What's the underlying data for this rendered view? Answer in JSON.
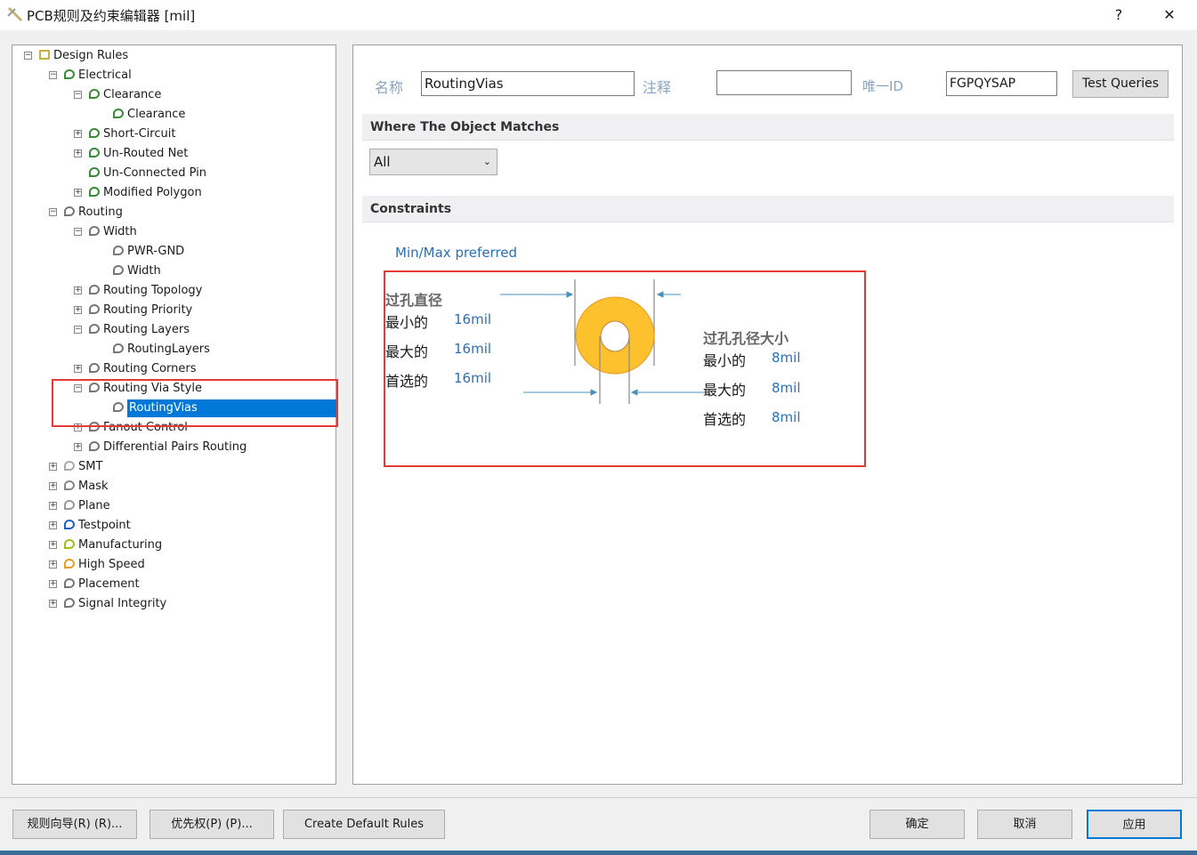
{
  "window": {
    "title": "PCB规则及约束编辑器 [mil]",
    "help": "?",
    "close": "✕"
  },
  "tree": [
    {
      "level": 0,
      "exp": "minus",
      "label": "Design Rules",
      "icon": "folder-icon"
    },
    {
      "level": 1,
      "exp": "minus",
      "label": "Electrical",
      "icon": "electrical-rule-icon"
    },
    {
      "level": 2,
      "exp": "minus",
      "label": "Clearance",
      "icon": "electrical-rule-icon"
    },
    {
      "level": 3,
      "exp": "",
      "label": "Clearance",
      "icon": "electrical-rule-icon"
    },
    {
      "level": 2,
      "exp": "plus",
      "label": "Short-Circuit",
      "icon": "electrical-rule-icon"
    },
    {
      "level": 2,
      "exp": "plus",
      "label": "Un-Routed Net",
      "icon": "electrical-rule-icon"
    },
    {
      "level": 2,
      "exp": "",
      "label": "Un-Connected Pin",
      "icon": "electrical-rule-icon"
    },
    {
      "level": 2,
      "exp": "plus",
      "label": "Modified Polygon",
      "icon": "electrical-rule-icon"
    },
    {
      "level": 1,
      "exp": "minus",
      "label": "Routing",
      "icon": "routing-rule-icon"
    },
    {
      "level": 2,
      "exp": "minus",
      "label": "Width",
      "icon": "routing-rule-icon"
    },
    {
      "level": 3,
      "exp": "",
      "label": "PWR-GND",
      "icon": "routing-rule-icon"
    },
    {
      "level": 3,
      "exp": "",
      "label": "Width",
      "icon": "routing-rule-icon"
    },
    {
      "level": 2,
      "exp": "plus",
      "label": "Routing Topology",
      "icon": "routing-rule-icon"
    },
    {
      "level": 2,
      "exp": "plus",
      "label": "Routing Priority",
      "icon": "routing-rule-icon"
    },
    {
      "level": 2,
      "exp": "minus",
      "label": "Routing Layers",
      "icon": "routing-rule-icon"
    },
    {
      "level": 3,
      "exp": "",
      "label": "RoutingLayers",
      "icon": "routing-rule-icon"
    },
    {
      "level": 2,
      "exp": "plus",
      "label": "Routing Corners",
      "icon": "routing-rule-icon"
    },
    {
      "level": 2,
      "exp": "minus",
      "label": "Routing Via Style",
      "icon": "routing-rule-icon"
    },
    {
      "level": 3,
      "exp": "",
      "label": "RoutingVias",
      "icon": "routing-rule-icon",
      "selected": true
    },
    {
      "level": 2,
      "exp": "plus",
      "label": "Fanout Control",
      "icon": "routing-rule-icon"
    },
    {
      "level": 2,
      "exp": "plus",
      "label": "Differential Pairs Routing",
      "icon": "routing-rule-icon"
    },
    {
      "level": 1,
      "exp": "plus",
      "label": "SMT",
      "icon": "smt-icon"
    },
    {
      "level": 1,
      "exp": "plus",
      "label": "Mask",
      "icon": "mask-icon"
    },
    {
      "level": 1,
      "exp": "plus",
      "label": "Plane",
      "icon": "plane-icon"
    },
    {
      "level": 1,
      "exp": "plus",
      "label": "Testpoint",
      "icon": "testpoint-icon"
    },
    {
      "level": 1,
      "exp": "plus",
      "label": "Manufacturing",
      "icon": "manufacturing-icon"
    },
    {
      "level": 1,
      "exp": "plus",
      "label": "High Speed",
      "icon": "high-speed-icon"
    },
    {
      "level": 1,
      "exp": "plus",
      "label": "Placement",
      "icon": "placement-icon"
    },
    {
      "level": 1,
      "exp": "plus",
      "label": "Signal Integrity",
      "icon": "signal-integrity-icon"
    }
  ],
  "form": {
    "name_label": "名称",
    "name_value": "RoutingVias",
    "comment_label": "注释",
    "comment_value": "",
    "id_label": "唯一ID",
    "id_value": "FGPQYSAP",
    "test_queries": "Test Queries"
  },
  "where": {
    "title": "Where The Object Matches",
    "selected": "All"
  },
  "constraints": {
    "title": "Constraints",
    "mode": "Min/Max preferred",
    "diameter": {
      "title": "过孔直径",
      "min_label": "最小的",
      "min": "16mil",
      "max_label": "最大的",
      "max": "16mil",
      "pref_label": "首选的",
      "pref": "16mil"
    },
    "hole": {
      "title": "过孔孔径大小",
      "min_label": "最小的",
      "min": "8mil",
      "max_label": "最大的",
      "max": "8mil",
      "pref_label": "首选的",
      "pref": "8mil"
    },
    "via_color": "#fcc12d",
    "highlight_color": "#e53935"
  },
  "footer": {
    "wizard": "规则向导(R) (R)...",
    "priority": "优先权(P) (P)...",
    "create_default": "Create Default Rules",
    "ok": "确定",
    "cancel": "取消",
    "apply": "应用"
  }
}
